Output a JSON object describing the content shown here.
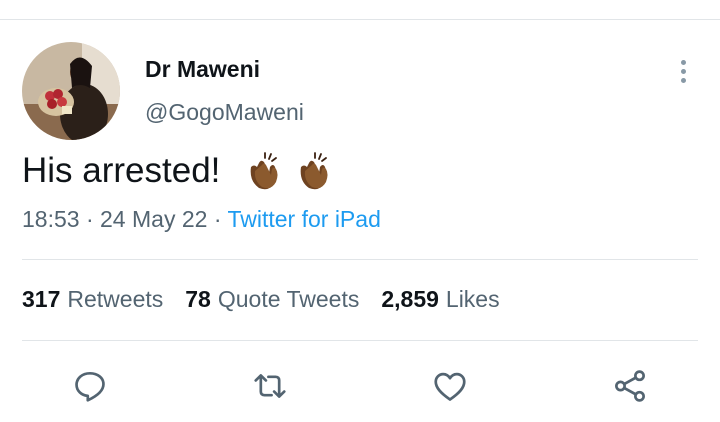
{
  "tweet": {
    "author": {
      "display_name": "Dr Maweni",
      "handle": "@GogoMaweni"
    },
    "text": "His arrested!",
    "emojis": [
      "clapping-hands-medium-dark",
      "clapping-hands-medium-dark"
    ],
    "time": "18:53",
    "date": "24 May 22",
    "separator": "·",
    "source": "Twitter for iPad",
    "stats": {
      "retweets_count": "317",
      "retweets_label": "Retweets",
      "quotes_count": "78",
      "quotes_label": "Quote Tweets",
      "likes_count": "2,859",
      "likes_label": "Likes"
    }
  },
  "actions": [
    "reply-icon",
    "retweet-icon",
    "like-icon",
    "share-icon"
  ],
  "colors": {
    "text": "#0f1419",
    "secondary": "#536471",
    "link": "#1d9bf0",
    "icon": "#536471",
    "divider": "#e1e5e8",
    "emoji": "#7a4a26"
  }
}
